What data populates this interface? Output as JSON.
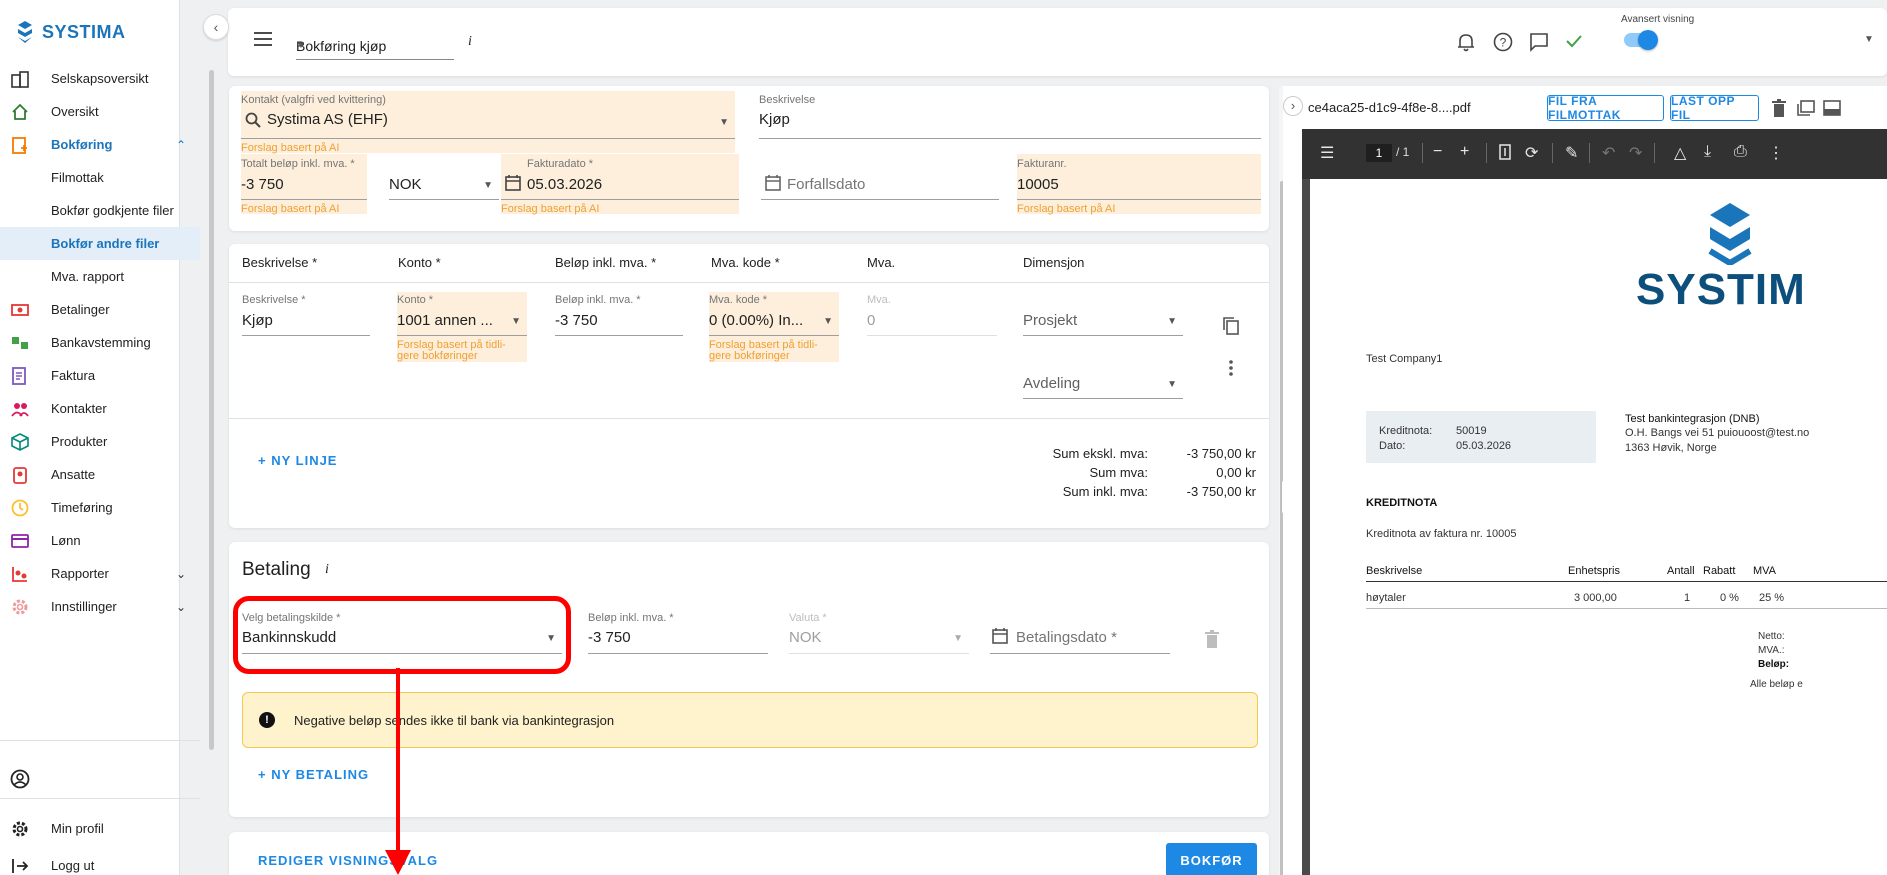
{
  "brand": {
    "name": "SYSTIMA",
    "color": "#1b75bb"
  },
  "sidebar": {
    "items": [
      {
        "label": "Selskapsoversikt",
        "icon": "company-overview-icon"
      },
      {
        "label": "Oversikt",
        "icon": "home-icon"
      },
      {
        "label": "Bokføring",
        "icon": "bookkeeping-icon"
      },
      {
        "label": "Betalinger",
        "icon": "payments-icon"
      },
      {
        "label": "Bankavstemming",
        "icon": "bank-reconciliation-icon"
      },
      {
        "label": "Faktura",
        "icon": "invoice-icon"
      },
      {
        "label": "Kontakter",
        "icon": "contacts-icon"
      },
      {
        "label": "Produkter",
        "icon": "products-icon"
      },
      {
        "label": "Ansatte",
        "icon": "employees-icon"
      },
      {
        "label": "Timeføring",
        "icon": "clock-icon"
      },
      {
        "label": "Lønn",
        "icon": "payroll-icon"
      },
      {
        "label": "Rapporter",
        "icon": "reports-icon"
      },
      {
        "label": "Innstillinger",
        "icon": "settings-icon"
      }
    ],
    "subitems": [
      "Filmottak",
      "Bokfør godkjente filer",
      "Bokfør andre filer",
      "Mva. rapport"
    ],
    "bottom": [
      {
        "label": "Min profil",
        "icon": "profile-gear-icon"
      },
      {
        "label": "Logg ut",
        "icon": "logout-icon"
      }
    ]
  },
  "topbar": {
    "mode_select": "Bokføring kjøp",
    "info": "i",
    "advanced_label": "Avansert visning"
  },
  "header_form": {
    "contact_label": "Kontakt (valgfri ved kvittering)",
    "contact_value": "Systima AS (EHF)",
    "ai_hint": "Forslag basert på AI",
    "description_label": "Beskrivelse",
    "description_value": "Kjøp",
    "total_label": "Totalt beløp inkl. mva. *",
    "total_value": "-3 750",
    "currency_value": "NOK",
    "invoice_date_label": "Fakturadato *",
    "invoice_date_value": "05.03.2026",
    "due_date_placeholder": "Forfallsdato",
    "invoice_no_label": "Fakturanr.",
    "invoice_no_value": "10005"
  },
  "lines": {
    "headers": [
      "Beskrivelse *",
      "Konto *",
      "Beløp inkl. mva. *",
      "Mva. kode *",
      "Mva.",
      "Dimensjon"
    ],
    "row": {
      "desc_label": "Beskrivelse *",
      "desc_value": "Kjøp",
      "account_label": "Konto *",
      "account_value": "1001 annen ...",
      "account_hint": "Forslag basert på tidli-\ngere bokføringer",
      "amount_label": "Beløp inkl. mva. *",
      "amount_value": "-3 750",
      "vat_code_label": "Mva. kode *",
      "vat_code_value": "0 (0.00%) In...",
      "vat_code_hint": "Forslag basert på tidli-\ngere bokføringer",
      "vat_label": "Mva.",
      "vat_value": "0",
      "project_placeholder": "Prosjekt",
      "department_placeholder": "Avdeling"
    },
    "new_line": "+ NY LINJE",
    "sums": [
      {
        "label": "Sum ekskl. mva:",
        "value": "-3 750,00 kr"
      },
      {
        "label": "Sum mva:",
        "value": "0,00 kr"
      },
      {
        "label": "Sum inkl. mva:",
        "value": "-3 750,00 kr"
      }
    ]
  },
  "payment": {
    "title": "Betaling",
    "info": "i",
    "source_label": "Velg betalingskilde *",
    "source_value": "Bankinnskudd",
    "amount_label": "Beløp inkl. mva. *",
    "amount_value": "-3 750",
    "currency_label": "Valuta *",
    "currency_value": "NOK",
    "date_placeholder": "Betalingsdato *",
    "alert": "Negative beløp sendes ikke til bank via bankintegrasjon",
    "new_payment": "+ NY BETALING"
  },
  "footer": {
    "edit_view": "REDIGER VISNINGSVALG",
    "post": "BOKFØR"
  },
  "pdf": {
    "filename": "ce4aca25-d1c9-4f8e-8....pdf",
    "btn_from_inbox": "FIL FRA FILMOTTAK",
    "btn_upload": "LAST OPP FIL",
    "page_current": "1",
    "page_total": "/ 1",
    "doc": {
      "logo_text": "SYSTIM",
      "company": "Test Company1",
      "kv": [
        {
          "k": "Kreditnota:",
          "v": "50019"
        },
        {
          "k": "Dato:",
          "v": "05.03.2026"
        }
      ],
      "recipient_name": "Test bankintegrasjon (DNB)",
      "recipient_line1": "O.H. Bangs vei 51 puiouoost@test.no",
      "recipient_line2": "1363 Høvik, Norge",
      "title": "KREDITNOTA",
      "subtitle": "Kreditnota av faktura nr. 10005",
      "table_headers": [
        "Beskrivelse",
        "Enhetspris",
        "Antall",
        "Rabatt",
        "MVA"
      ],
      "table_row": [
        "høytaler",
        "3 000,00",
        "1",
        "0 %",
        "25 %"
      ],
      "totals": [
        "Netto:",
        "MVA.:",
        "Beløp:"
      ],
      "footnote": "Alle beløp e"
    }
  }
}
